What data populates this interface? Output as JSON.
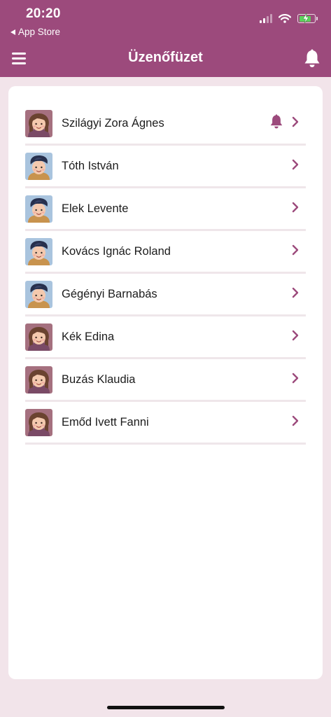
{
  "status": {
    "time": "20:20",
    "back_app": "App Store"
  },
  "header": {
    "title": "Üzenőfüzet"
  },
  "contacts": [
    {
      "name": "Szilágyi Zora Ágnes",
      "avatar": "girl-avatar",
      "notify": true
    },
    {
      "name": "Tóth István",
      "avatar": "boy-avatar",
      "notify": false
    },
    {
      "name": "Elek Levente",
      "avatar": "boy-avatar",
      "notify": false
    },
    {
      "name": "Kovács Ignác Roland",
      "avatar": "boy-avatar",
      "notify": false
    },
    {
      "name": "Gégényi Barnabás",
      "avatar": "boy-avatar",
      "notify": false
    },
    {
      "name": "Kék Edina",
      "avatar": "girl-avatar",
      "notify": false
    },
    {
      "name": "Buzás Klaudia",
      "avatar": "girl-avatar",
      "notify": false
    },
    {
      "name": "Emőd Ivett Fanni",
      "avatar": "girl-avatar",
      "notify": false
    }
  ],
  "colors": {
    "header": "#9c4a7c",
    "background": "#f2e4ea",
    "accent": "#9c4a7c"
  }
}
